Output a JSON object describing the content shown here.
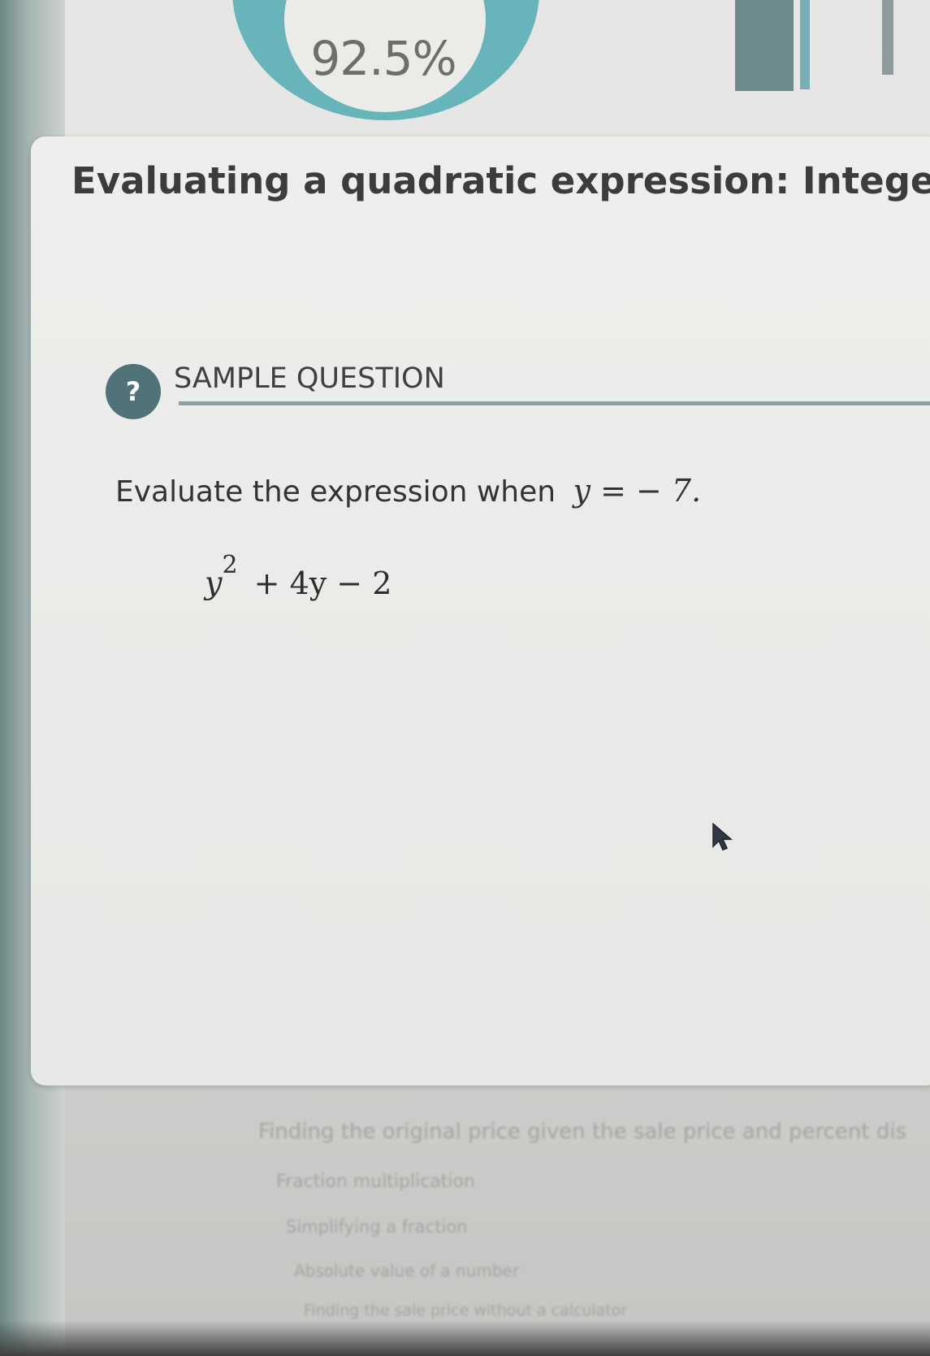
{
  "progress": {
    "percent_label": "92.5%",
    "value": 92.5
  },
  "lesson": {
    "title": "Evaluating a quadratic expression: Integers"
  },
  "sample": {
    "icon": "question-mark-icon",
    "icon_glyph": "?",
    "label": "SAMPLE QUESTION"
  },
  "question": {
    "prompt": "Evaluate the expression when",
    "condition": "y = − 7.",
    "expression": {
      "base": "y",
      "exponent": "2",
      "rest": "+ 4y − 2"
    }
  },
  "related_topics": [
    "Finding the original price given the sale price and percent dis",
    "Fraction multiplication",
    "Simplifying a fraction",
    "Absolute value of a number",
    "Finding the sale price without a calculator"
  ],
  "colors": {
    "accent_teal": "#67b5bb",
    "icon_bg": "#4f7376",
    "title_text": "#3c3c3c"
  }
}
